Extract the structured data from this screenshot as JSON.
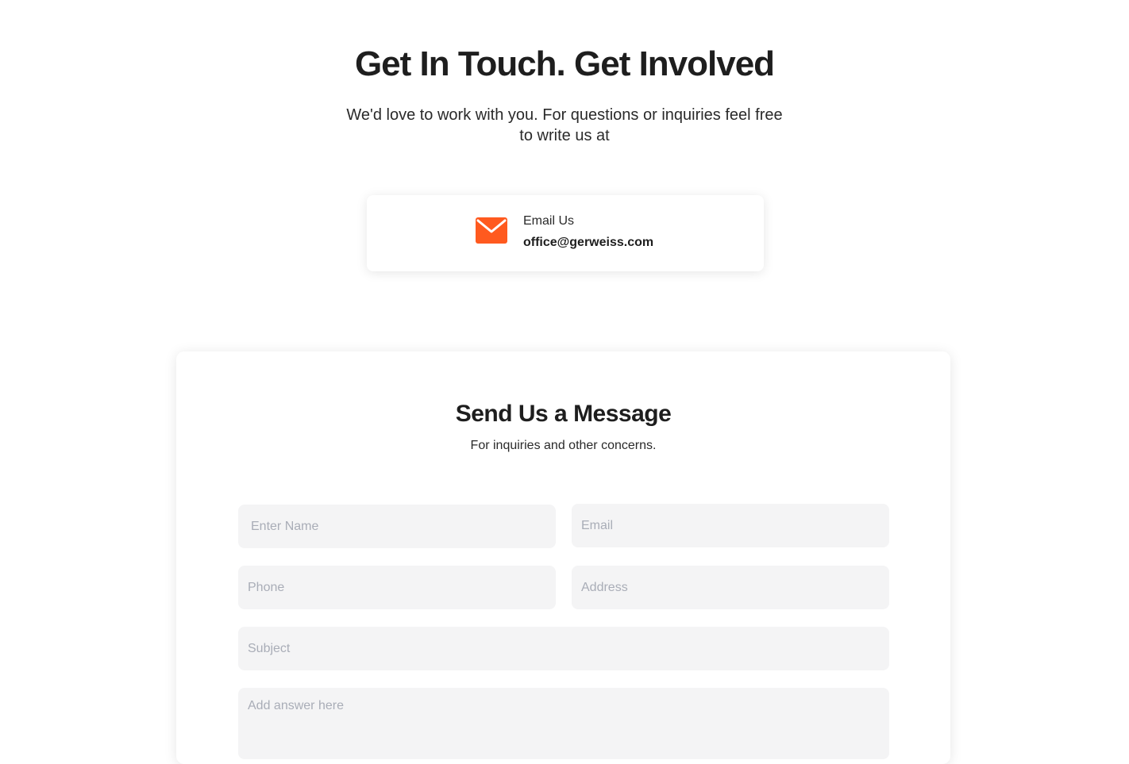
{
  "hero": {
    "title": "Get In Touch. Get Involved",
    "subtitle": "We'd love to work with you. For questions or inquiries feel free to write us at"
  },
  "email_card": {
    "icon": "envelope-icon",
    "label": "Email Us",
    "address": "office@gerweiss.com",
    "icon_color": "#ff5a1f"
  },
  "form": {
    "title": "Send Us a Message",
    "subtitle": "For inquiries and other concerns.",
    "fields": {
      "name_placeholder": "Enter Name",
      "email_placeholder": "Email",
      "phone_placeholder": "Phone",
      "address_placeholder": "Address",
      "subject_placeholder": "Subject",
      "answer_placeholder": "Add answer here"
    }
  },
  "colors": {
    "accent": "#ff5a1f",
    "field_background": "#f4f4f5",
    "placeholder": "#a9adb7"
  }
}
